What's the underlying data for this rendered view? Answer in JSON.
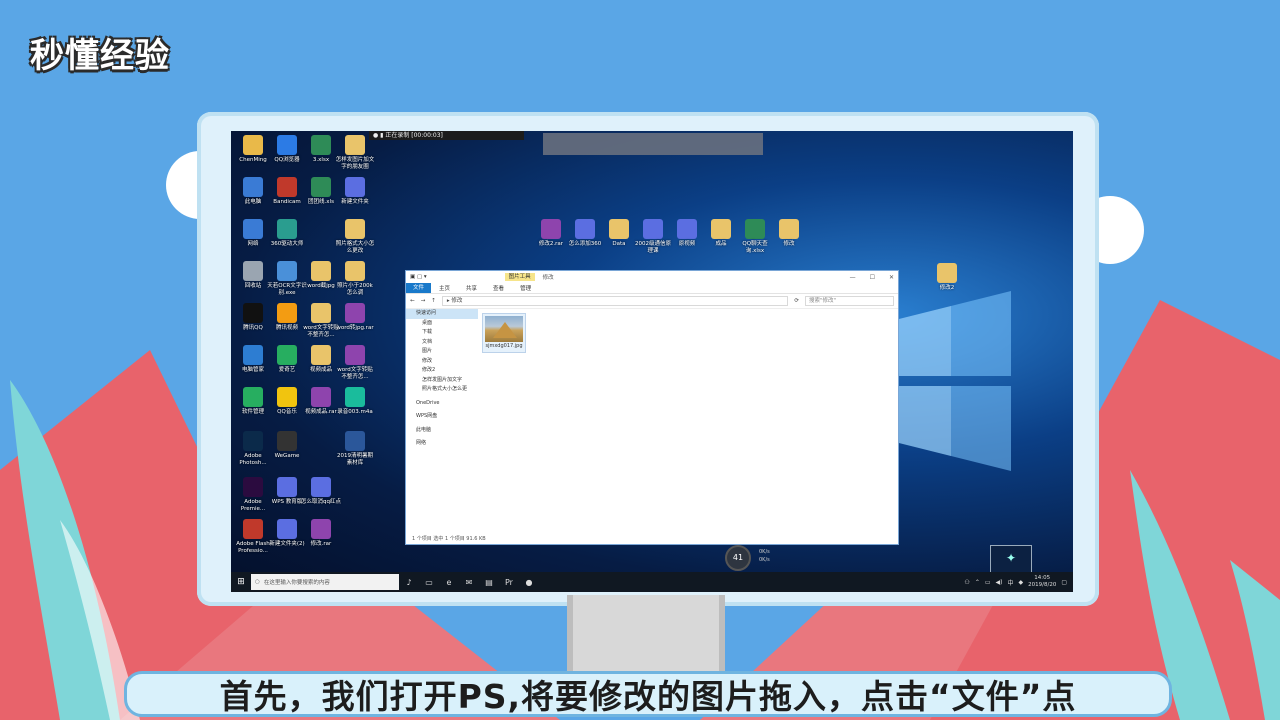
{
  "logo": {
    "text": "秒懂经验"
  },
  "recorder": {
    "status": "正在录制 [00:00:03]"
  },
  "desktop_icons": [
    {
      "label": "ChenMing",
      "color": "#e9b949"
    },
    {
      "label": "QQ浏览器",
      "color": "#2c7be5"
    },
    {
      "label": "3.xlsx",
      "color": "#2e8b57"
    },
    {
      "label": "怎样发图片加文字的朋友圈",
      "color": "#e9c46a"
    },
    {
      "label": "此电脑",
      "color": "#3a7bd5"
    },
    {
      "label": "Bandicam",
      "color": "#c0392b"
    },
    {
      "label": "团团线.xls",
      "color": "#2e8b57"
    },
    {
      "label": "新建文件夹",
      "color": "#5b6ee1"
    },
    {
      "label": "网络",
      "color": "#3a7bd5"
    },
    {
      "label": "360驱动大师",
      "color": "#2a9d8f"
    },
    {
      "label": "照片格式大小怎么更改",
      "color": "#e9c46a"
    },
    {
      "label": "回收站",
      "color": "#9aa5b1"
    },
    {
      "label": "天若OCR文字识别.exe",
      "color": "#4a90d9"
    },
    {
      "label": "word截jpg",
      "color": "#e9c46a"
    },
    {
      "label": "照片小于200k怎么调",
      "color": "#e9c46a"
    },
    {
      "label": "腾讯QQ",
      "color": "#111111"
    },
    {
      "label": "腾讯视频",
      "color": "#f39c12"
    },
    {
      "label": "word文字转贴不整齐怎...",
      "color": "#e9c46a"
    },
    {
      "label": "word转jpg.rar",
      "color": "#8e44ad"
    },
    {
      "label": "电脑管家",
      "color": "#2d7dd2"
    },
    {
      "label": "爱奇艺",
      "color": "#27ae60"
    },
    {
      "label": "视频成品",
      "color": "#e9c46a"
    },
    {
      "label": "word文字转贴不整齐怎...",
      "color": "#8e44ad"
    },
    {
      "label": "软件管理",
      "color": "#27ae60"
    },
    {
      "label": "QQ音乐",
      "color": "#f1c40f"
    },
    {
      "label": "视频成品.rar",
      "color": "#8e44ad"
    },
    {
      "label": "录音003.m4a",
      "color": "#1abc9c"
    },
    {
      "label": "Adobe Photosh...",
      "color": "#0b2a4a"
    },
    {
      "label": "WeGame",
      "color": "#333333"
    },
    {
      "label": "2019清明暑期素材库",
      "color": "#2b579a"
    },
    {
      "label": "Adobe Premie...",
      "color": "#2b0b3f"
    },
    {
      "label": "WPS 教育版",
      "color": "#5b6ee1"
    },
    {
      "label": "怎么取消qq红点",
      "color": "#5b6ee1"
    },
    {
      "label": "Adobe Flash Professio...",
      "color": "#c0392b"
    },
    {
      "label": "新建文件夹(2)",
      "color": "#5b6ee1"
    },
    {
      "label": "修改.rar",
      "color": "#8e44ad"
    },
    {
      "label": "修改2.rar",
      "color": "#8e44ad"
    },
    {
      "label": "怎么添加360",
      "color": "#5b6ee1"
    },
    {
      "label": "Data",
      "color": "#e9c46a"
    },
    {
      "label": "2002级通信原理课",
      "color": "#5b6ee1"
    },
    {
      "label": "原视频",
      "color": "#5b6ee1"
    },
    {
      "label": "成品",
      "color": "#e9c46a"
    },
    {
      "label": "QQ聊天查询.xlsx",
      "color": "#2e8b57"
    },
    {
      "label": "修改",
      "color": "#e9c46a"
    },
    {
      "label": "修改2",
      "color": "#e9c46a"
    }
  ],
  "explorer": {
    "title_tools": "图片工具",
    "title_folder": "修改",
    "ribbon_tabs": [
      "文件",
      "主页",
      "共享",
      "查看",
      "管理"
    ],
    "path": "修改",
    "search_placeholder": "搜索\"修改\"",
    "nav": [
      "快速访问",
      "桌面",
      "下载",
      "文档",
      "图片",
      "修改",
      "修改2",
      "怎样发图片加文字",
      "照片格式大小怎么更",
      "OneDrive",
      "WPS网盘",
      "此电脑",
      "网络"
    ],
    "file_name": "sjmxdg017.jpg",
    "status": "1 个项目    选中 1 个项目  91.6 KB"
  },
  "speed_meter": {
    "value": "41",
    "unit": "%",
    "up": "0K/s",
    "down": "0K/s"
  },
  "taskbar": {
    "search_placeholder": "在这里输入你要搜索的内容",
    "time": "14:05",
    "date": "2019/8/20",
    "ime": "中"
  },
  "subtitle": {
    "text": "首先，我们打开PS,将要修改的图片拖入，点击“文件”点"
  }
}
